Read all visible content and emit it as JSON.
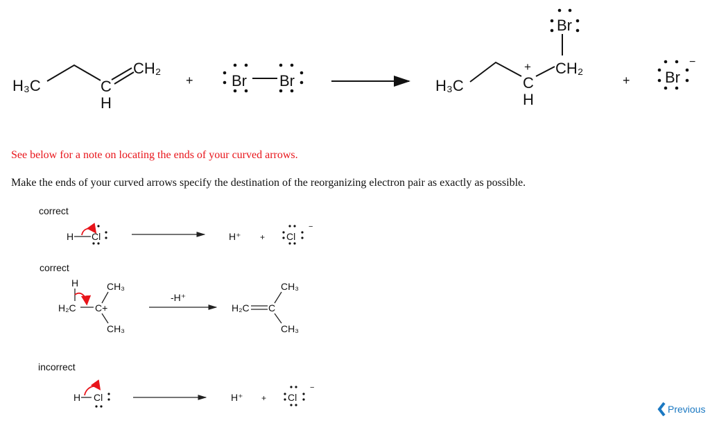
{
  "reaction": {
    "reactant1": {
      "left": "H₃C",
      "carbon": "C",
      "hydrogen": "H",
      "right": "CH₂"
    },
    "plus1": "+",
    "reactant2": {
      "atom1": "Br",
      "atom2": "Br"
    },
    "product1": {
      "left": "H₃C",
      "carbon": "C",
      "charge": "+",
      "hydrogen": "H",
      "right": "CH₂",
      "top": "Br"
    },
    "plus2": "+",
    "product2": {
      "atom": "Br",
      "charge": "−"
    }
  },
  "notes": {
    "red": "See below for a note on locating the ends of your curved arrows.",
    "black": "Make the ends of your curved arrows specify the destination of the reorganizing electron pair as exactly as possible."
  },
  "examples": [
    {
      "label": "correct",
      "h": "H",
      "cl": "Cl",
      "hplus": "H⁺",
      "plus": "+",
      "cl2": "Cl",
      "minus": "−"
    },
    {
      "label": "correct",
      "h": "H",
      "h2c": "H₂C",
      "cplus": "C+",
      "ch3a": "CH₃",
      "ch3b": "CH₃",
      "condition": "-H⁺",
      "p_h2c": "H₂C",
      "p_c": "C",
      "p_ch3a": "CH₃",
      "p_ch3b": "CH₃"
    },
    {
      "label": "incorrect",
      "h": "H",
      "cl": "Cl",
      "hplus": "H⁺",
      "plus": "+",
      "cl2": "Cl",
      "minus": "−"
    }
  ],
  "nav": {
    "previous_label": "Previous",
    "previous_icon": "chevron-left-icon",
    "link_color": "#1a78c2"
  },
  "colors": {
    "arrow_red": "#e8141a",
    "note_red": "#e8141a"
  }
}
